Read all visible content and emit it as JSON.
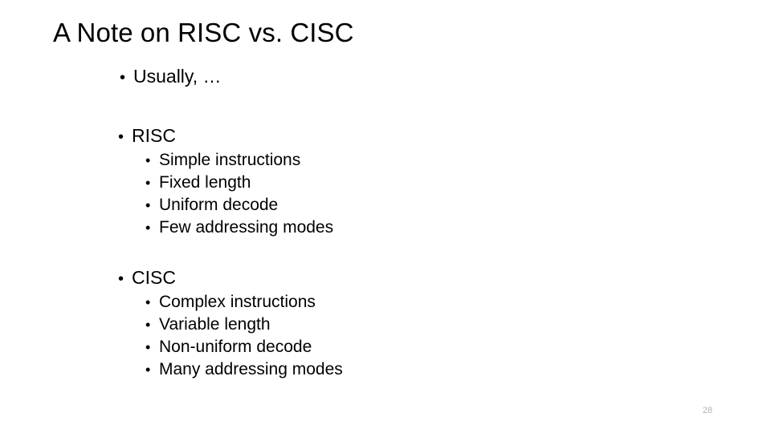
{
  "slide": {
    "title": "A Note on RISC vs. CISC",
    "number": "28",
    "background_color": "#ffffff",
    "text_color": "#000000",
    "number_color": "#b4b4b4",
    "bullet_glyph": "•"
  },
  "content": {
    "intro": {
      "marker": "•",
      "text": "Usually, …"
    },
    "sections": [
      {
        "marker": "•",
        "heading": "RISC",
        "items": [
          {
            "marker": "•",
            "text": "Simple instructions"
          },
          {
            "marker": "•",
            "text": "Fixed length"
          },
          {
            "marker": "•",
            "text": "Uniform decode"
          },
          {
            "marker": "•",
            "text": "Few addressing modes"
          }
        ]
      },
      {
        "marker": "•",
        "heading": "CISC",
        "items": [
          {
            "marker": "•",
            "text": "Complex instructions"
          },
          {
            "marker": "•",
            "text": "Variable length"
          },
          {
            "marker": "•",
            "text": "Non-uniform decode"
          },
          {
            "marker": "•",
            "text": "Many addressing modes"
          }
        ]
      }
    ]
  }
}
